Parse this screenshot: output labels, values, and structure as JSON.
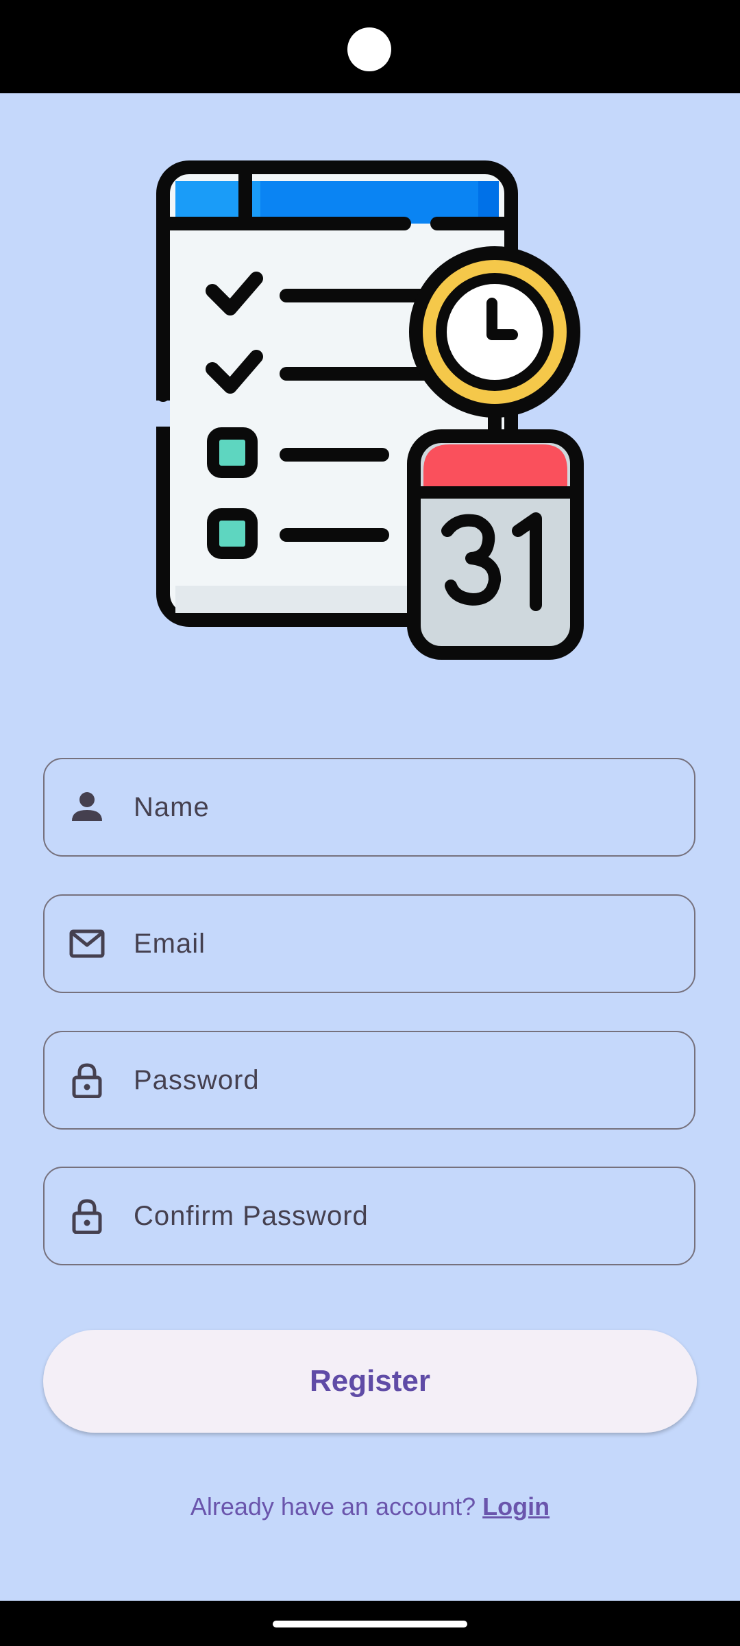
{
  "form": {
    "name_placeholder": "Name",
    "email_placeholder": "Email",
    "password_placeholder": "Password",
    "confirm_password_placeholder": "Confirm Password",
    "name_icon": "person-icon",
    "email_icon": "mail-icon",
    "password_icon": "lock-icon",
    "confirm_password_icon": "lock-icon"
  },
  "register_button": {
    "label": "Register"
  },
  "footer": {
    "prompt": "Already have an account?",
    "login_link": "Login"
  },
  "illustration": {
    "calendar_day": "31",
    "icon": "task-checklist-calendar-icon"
  },
  "colors": {
    "background": "#c5d8fb",
    "accent": "#5f4ba6",
    "button_bg": "#f4eff7"
  }
}
